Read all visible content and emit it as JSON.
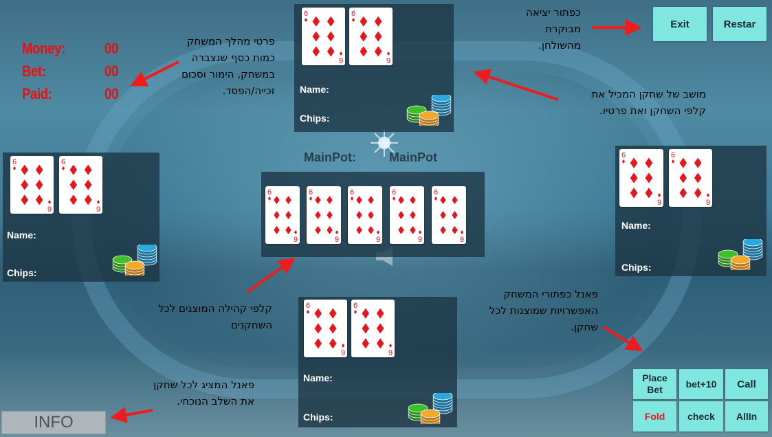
{
  "hud": {
    "money_label": "Money:",
    "money_value": "00",
    "bet_label": "Bet:",
    "bet_value": "00",
    "paid_label": "Paid:",
    "paid_value": "00"
  },
  "top_buttons": {
    "exit": "Exit",
    "restart": "Restar"
  },
  "pot": {
    "label": "MainPot:",
    "value": "MainPot"
  },
  "seat": {
    "name_label": "Name:",
    "chips_label": "Chips:"
  },
  "card": {
    "rank": "6",
    "rank_bottom": "9",
    "suit": "diamonds",
    "suit_color": "#e8151b"
  },
  "action_buttons": {
    "place_bet_line1": "Place",
    "place_bet_line2": "Bet",
    "bet10": "bet+10",
    "call": "Call",
    "fold": "Fold",
    "check": "check",
    "allin": "AllIn"
  },
  "info_label": "INFO",
  "annotations": {
    "exit": [
      "כפתור יציאה",
      "מבוקרת",
      "מהשולחן."
    ],
    "hud": [
      "פרטי מהלך המשחק",
      "כמות כסף שנצברה",
      "במשחק, הימור וסכום",
      "זכייה/הפסד."
    ],
    "seat": [
      "מושב של שחקן המכיל את",
      "קלפי השחקן ואת פרטיו."
    ],
    "community": [
      "קלפי קהילה המוצגים לכל",
      "השחקנים"
    ],
    "actions": [
      "פאנל כפתורי המשחק",
      "האפשרויות שמוצגות לכל",
      "שחקן."
    ],
    "info": [
      "פאנל המציג לכל שחקן",
      "את השלב הנוכחי."
    ]
  },
  "colors": {
    "hud_red": "#e81010",
    "button_teal": "#7fe6e0",
    "fold_red": "#e8151b",
    "arrow_red": "#ee1c1c"
  }
}
